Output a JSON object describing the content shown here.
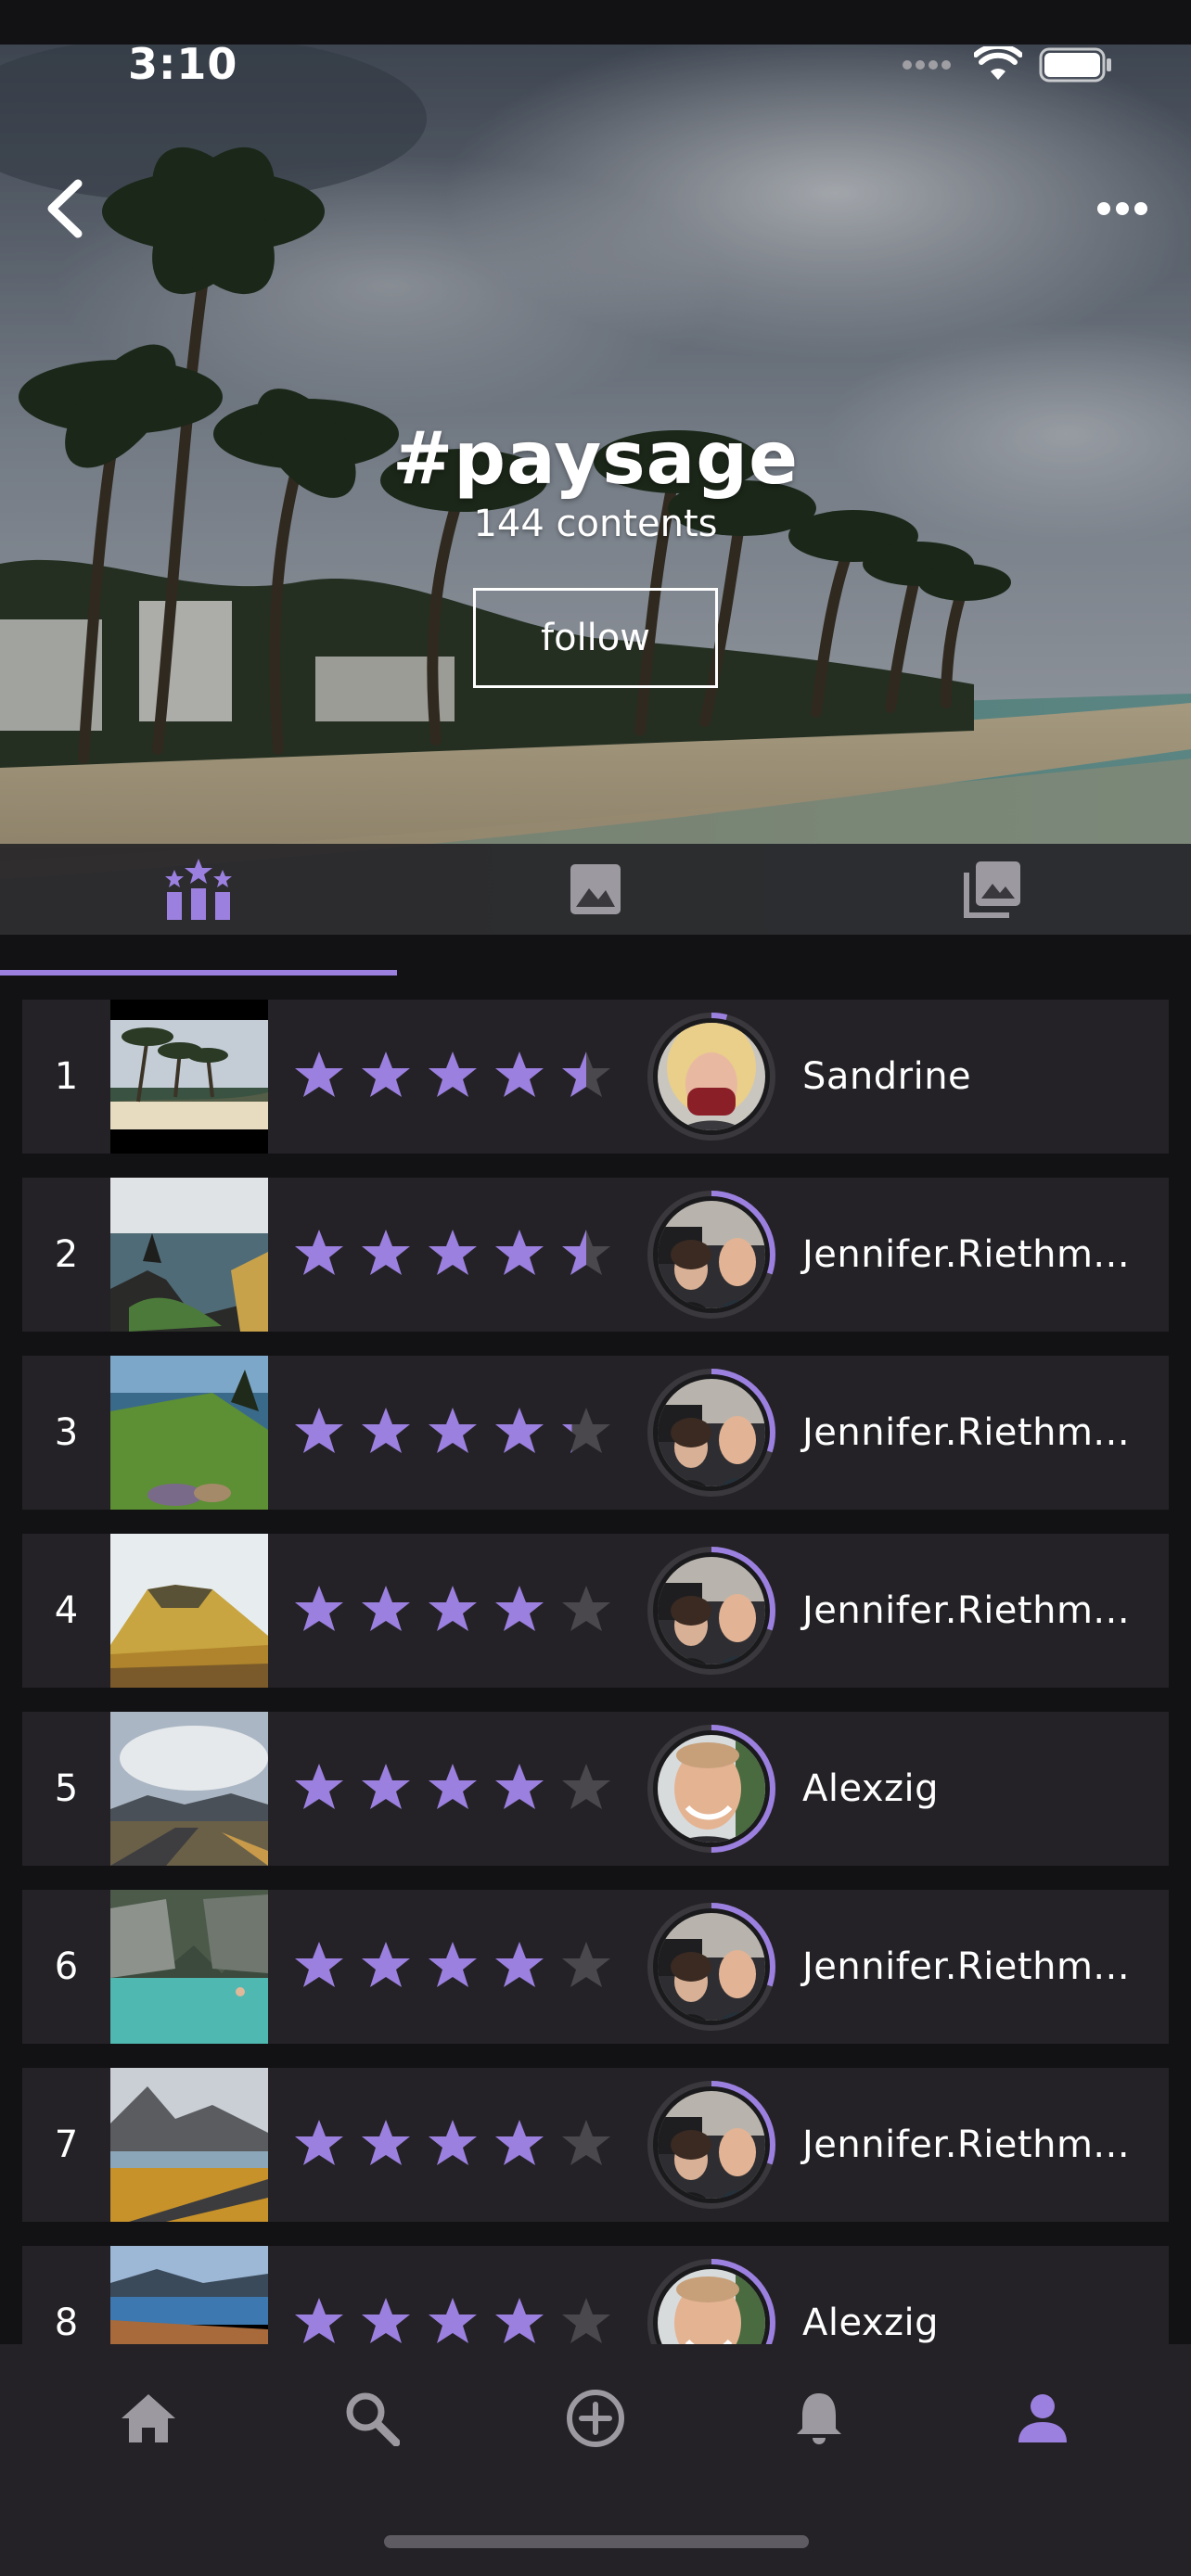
{
  "status_bar": {
    "time": "3:10",
    "icons": [
      "signal-icon",
      "wifi-icon",
      "battery-icon"
    ]
  },
  "header": {
    "back_icon": "chevron-left-icon",
    "more_icon": "more-horizontal-icon",
    "title": "#paysage",
    "subtitle": "144 contents",
    "follow_label": "follow"
  },
  "tabs": [
    {
      "icon": "ranking-stars-icon",
      "active": true
    },
    {
      "icon": "image-icon",
      "active": false
    },
    {
      "icon": "image-collection-icon",
      "active": false
    }
  ],
  "colors": {
    "accent": "#9b80e0",
    "row_bg": "#242226",
    "page_bg": "#121114",
    "star_empty": "#4a484d"
  },
  "ranking": [
    {
      "rank": "1",
      "rating": 4.5,
      "user": "Sandrine",
      "avatar": "avatar-woman-mask",
      "photo": "palm-beach"
    },
    {
      "rank": "2",
      "rating": 4.5,
      "user": "Jennifer.Riethm...",
      "avatar": "avatar-couple",
      "photo": "coastal-cliffs"
    },
    {
      "rank": "3",
      "rating": 4.2,
      "user": "Jennifer.Riethm...",
      "avatar": "avatar-couple",
      "photo": "green-sea-stack"
    },
    {
      "rank": "4",
      "rating": 4.0,
      "user": "Jennifer.Riethm...",
      "avatar": "avatar-couple",
      "photo": "golden-mountain"
    },
    {
      "rank": "5",
      "rating": 4.0,
      "user": "Alexzig",
      "avatar": "avatar-man",
      "photo": "road-clouds"
    },
    {
      "rank": "6",
      "rating": 4.0,
      "user": "Jennifer.Riethm...",
      "avatar": "avatar-couple",
      "photo": "lagoon-cliffs"
    },
    {
      "rank": "7",
      "rating": 4.0,
      "user": "Jennifer.Riethm...",
      "avatar": "avatar-couple",
      "photo": "valley-road"
    },
    {
      "rank": "8",
      "rating": 4.0,
      "user": "Alexzig",
      "avatar": "avatar-man",
      "photo": "lake-shore"
    }
  ],
  "bottom_nav": [
    {
      "icon": "home-icon",
      "active": false
    },
    {
      "icon": "search-icon",
      "active": false
    },
    {
      "icon": "add-circle-icon",
      "active": false
    },
    {
      "icon": "bell-icon",
      "active": false
    },
    {
      "icon": "profile-icon",
      "active": true
    }
  ]
}
